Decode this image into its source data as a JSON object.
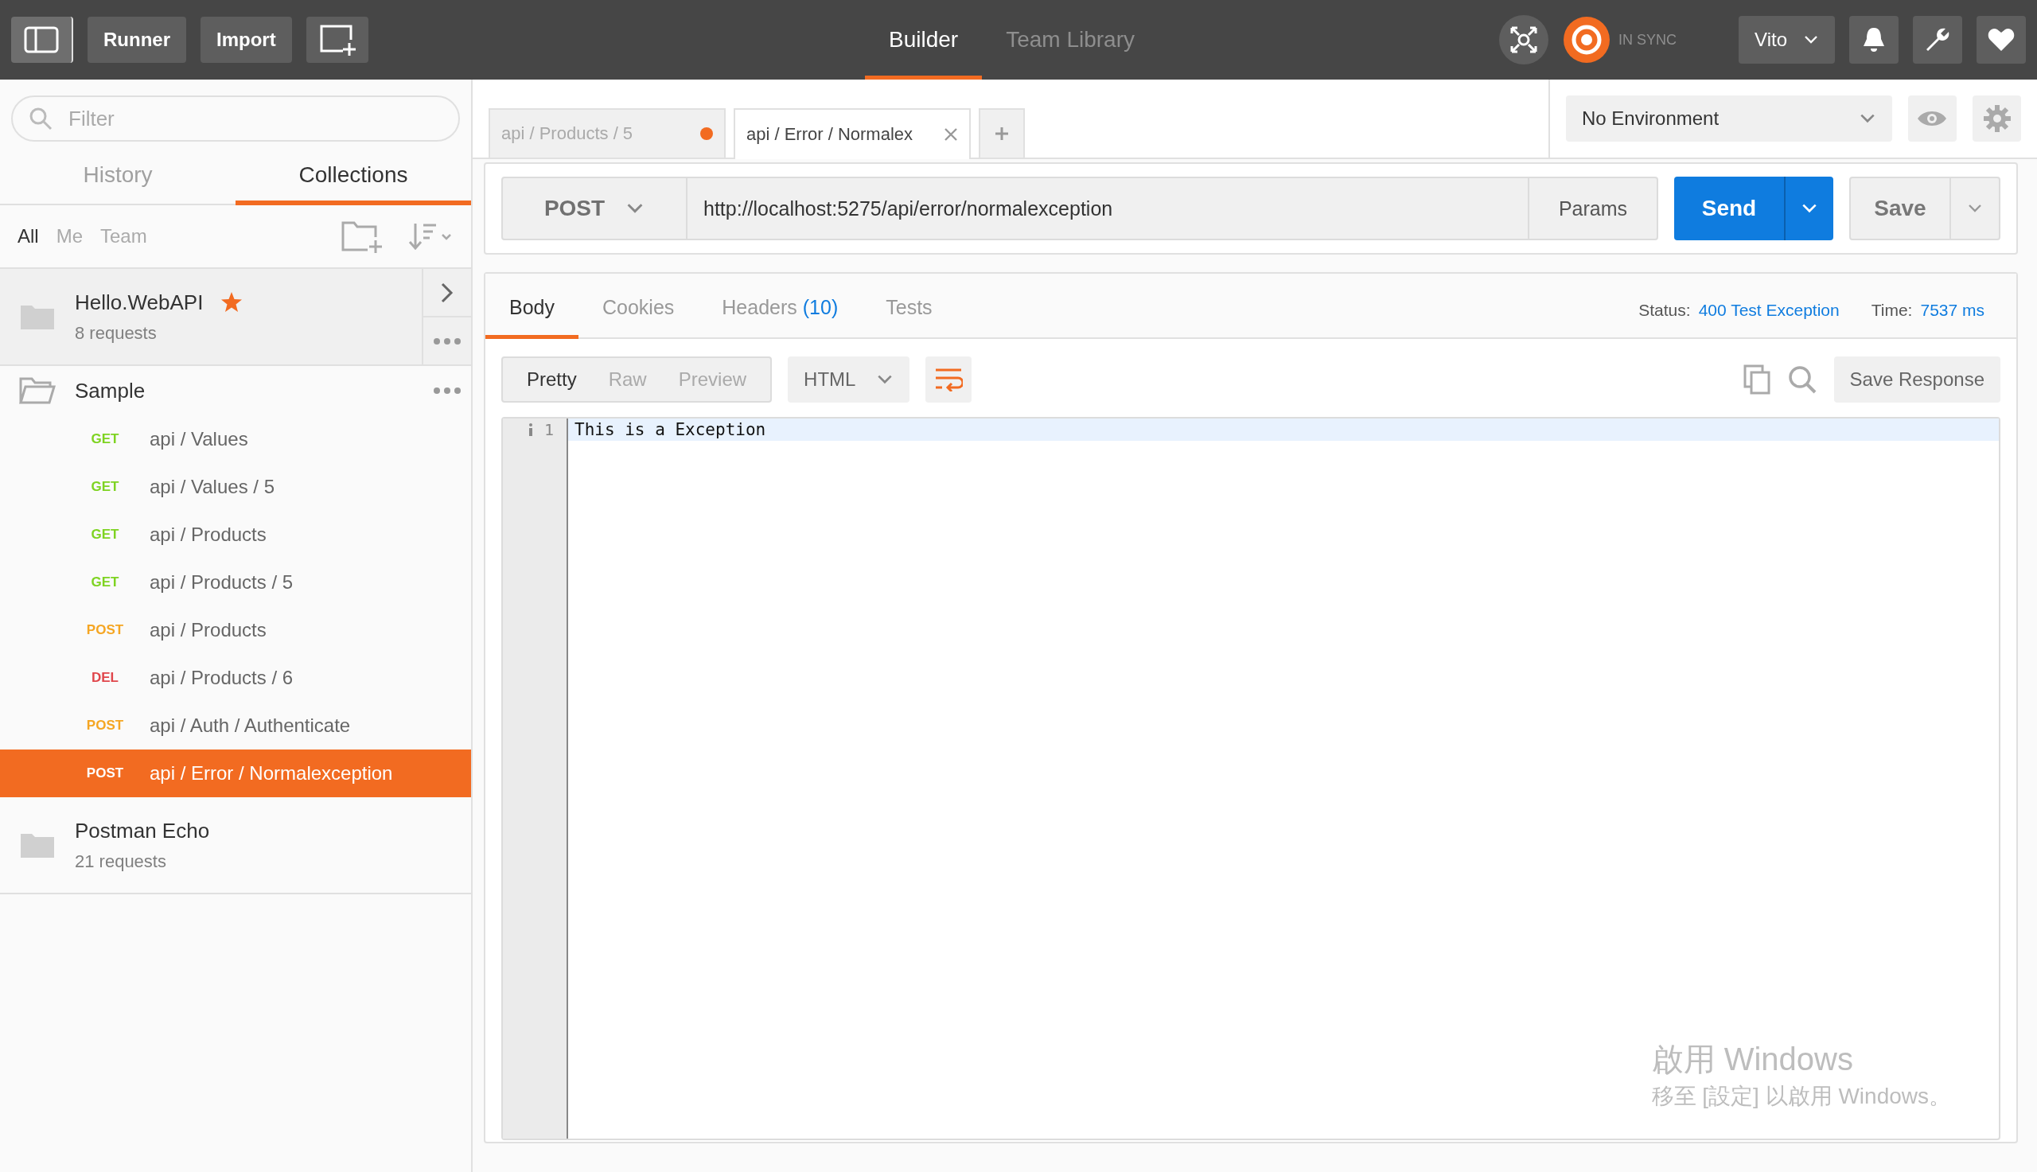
{
  "toolbar": {
    "buttons": [
      "Runner",
      "Import"
    ],
    "nav_tabs": [
      {
        "label": "Builder",
        "selected": true
      },
      {
        "label": "Team Library",
        "selected": false
      }
    ],
    "sync_status": "IN SYNC",
    "user": "Vito"
  },
  "sidebar": {
    "filter": {
      "placeholder": "Filter"
    },
    "tabs": [
      {
        "label": "History",
        "selected": false
      },
      {
        "label": "Collections",
        "selected": true
      }
    ],
    "owner_filters": [
      {
        "label": "All",
        "selected": true
      },
      {
        "label": "Me",
        "selected": false
      },
      {
        "label": "Team",
        "selected": false
      }
    ],
    "collections": [
      {
        "name": "Hello.WebAPI",
        "meta": "8 requests",
        "starred": true,
        "expanded": false,
        "highlighted": true
      },
      {
        "name": "Sample",
        "starred": false,
        "expanded": true,
        "highlighted": false,
        "requests": [
          {
            "method": "GET",
            "name": "api / Values",
            "selected": false
          },
          {
            "method": "GET",
            "name": "api / Values / 5",
            "selected": false
          },
          {
            "method": "GET",
            "name": "api / Products",
            "selected": false
          },
          {
            "method": "GET",
            "name": "api / Products / 5",
            "selected": false
          },
          {
            "method": "POST",
            "name": "api / Products",
            "selected": false
          },
          {
            "method": "DEL",
            "name": "api / Products / 6",
            "selected": false
          },
          {
            "method": "POST",
            "name": "api / Auth / Authenticate",
            "selected": false
          },
          {
            "method": "POST",
            "name": "api / Error / Normalexception",
            "selected": true
          }
        ]
      },
      {
        "name": "Postman Echo",
        "meta": "21 requests",
        "starred": false,
        "expanded": false,
        "highlighted": false
      }
    ]
  },
  "request_tabs": [
    {
      "label": "api / Products / 5",
      "selected": false,
      "unsaved": true
    },
    {
      "label": "api / Error / Normalex",
      "selected": true,
      "unsaved": false
    }
  ],
  "environment": {
    "value": "No Environment"
  },
  "request": {
    "method": "POST",
    "url": "http://localhost:5275/api/error/normalexception",
    "params": "Params",
    "send": "Send",
    "save": "Save"
  },
  "response": {
    "tabs": [
      {
        "label": "Body",
        "selected": true
      },
      {
        "label": "Cookies",
        "selected": false
      },
      {
        "label": "Headers",
        "count": "(10)",
        "selected": false
      },
      {
        "label": "Tests",
        "selected": false
      }
    ],
    "status_label": "Status:",
    "status": "400 Test Exception",
    "time_label": "Time:",
    "time": "7537 ms",
    "view_modes": [
      {
        "label": "Pretty",
        "selected": true
      },
      {
        "label": "Raw",
        "selected": false
      },
      {
        "label": "Preview",
        "selected": false
      }
    ],
    "format": "HTML",
    "save_response": "Save Response",
    "lines": [
      {
        "number": "1",
        "text": "This is a Exception"
      }
    ]
  },
  "os_notice": {
    "title": "啟用 Windows",
    "subtitle": "移至 [設定] 以啟用 Windows。"
  }
}
